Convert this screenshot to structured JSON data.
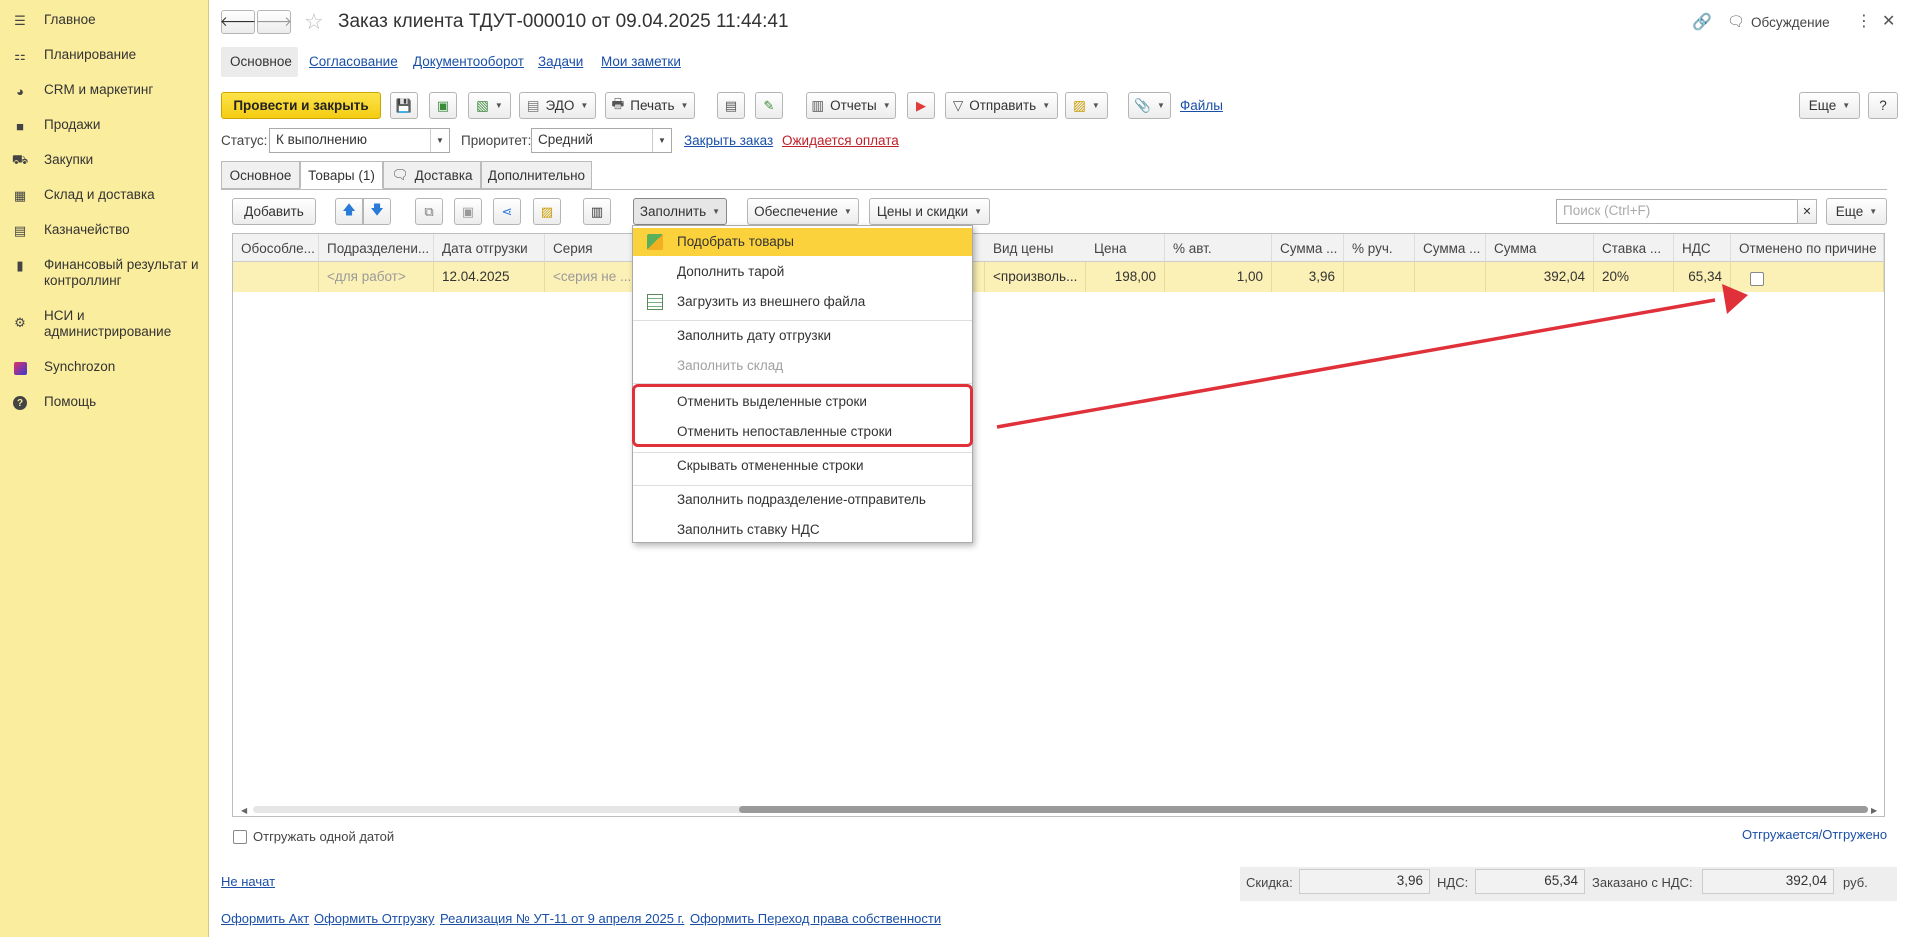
{
  "sidebar": {
    "items": [
      {
        "label": "Главное",
        "icon": "menu-icon"
      },
      {
        "label": "Планирование",
        "icon": "planning-icon"
      },
      {
        "label": "CRM и маркетинг",
        "icon": "pie-chart-icon"
      },
      {
        "label": "Продажи",
        "icon": "bag-icon"
      },
      {
        "label": "Закупки",
        "icon": "cart-icon"
      },
      {
        "label": "Склад и доставка",
        "icon": "warehouse-icon"
      },
      {
        "label": "Казначейство",
        "icon": "treasury-icon"
      },
      {
        "label": "Финансовый результат и контроллинг",
        "icon": "bar-chart-icon"
      },
      {
        "label": "НСИ и администрирование",
        "icon": "gear-icon"
      },
      {
        "label": "Synchrozon",
        "icon": "synchrozon-icon"
      },
      {
        "label": "Помощь",
        "icon": "help-icon"
      }
    ]
  },
  "header": {
    "title": "Заказ клиента ТДУТ-000010 от 09.04.2025 11:44:41",
    "discussion": "Обсуждение"
  },
  "nav_tabs": [
    "Основное",
    "Согласование",
    "Документооборот",
    "Задачи",
    "Мои заметки"
  ],
  "toolbar": {
    "post_close": "Провести и закрыть",
    "edo": "ЭДО",
    "print": "Печать",
    "reports": "Отчеты",
    "send": "Отправить",
    "files": "Файлы",
    "more": "Еще"
  },
  "status_row": {
    "status_label": "Статус:",
    "status_value": "К выполнению",
    "priority_label": "Приоритет:",
    "priority_value": "Средний",
    "close_order": "Закрыть заказ",
    "awaiting_payment": "Ожидается оплата"
  },
  "form_tabs": [
    "Основное",
    "Товары (1)",
    "Доставка",
    "Дополнительно"
  ],
  "goods_toolbar": {
    "add": "Добавить",
    "fill": "Заполнить",
    "provision": "Обеспечение",
    "prices": "Цены и скидки",
    "search_placeholder": "Поиск (Ctrl+F)",
    "more": "Еще"
  },
  "table": {
    "headers": [
      "Обособле...",
      "Подразделени...",
      "Дата отгрузки",
      "Серия",
      "Вид цены",
      "Цена",
      "% авт.",
      "Сумма ...",
      "% руч.",
      "Сумма ...",
      "Сумма",
      "Ставка ...",
      "НДС",
      "Отменено по причине"
    ],
    "row": [
      "",
      "<для работ>",
      "12.04.2025",
      "<серия не ...",
      "<произволь...",
      "198,00",
      "1,00",
      "3,96",
      "",
      "",
      "392,04",
      "20%",
      "65,34",
      ""
    ]
  },
  "fill_menu": {
    "items": [
      {
        "label": "Подобрать товары",
        "state": "selected"
      },
      {
        "label": "Дополнить тарой",
        "state": "normal"
      },
      {
        "label": "Загрузить из внешнего файла",
        "state": "normal"
      },
      {
        "label": "Заполнить дату отгрузки",
        "state": "normal"
      },
      {
        "label": "Заполнить склад",
        "state": "disabled"
      },
      {
        "label": "Отменить выделенные строки",
        "state": "normal"
      },
      {
        "label": "Отменить непоставленные строки",
        "state": "normal"
      },
      {
        "label": "Скрывать отмененные строки",
        "state": "normal"
      },
      {
        "label": "Заполнить подразделение-отправитель",
        "state": "normal"
      },
      {
        "label": "Заполнить ставку НДС",
        "state": "normal"
      }
    ]
  },
  "footer": {
    "ship_one_date": "Отгружать одной датой",
    "shipped_link": "Отгружается/Отгружено",
    "not_started": "Не начат",
    "discount_label": "Скидка:",
    "discount_value": "3,96",
    "vat_label": "НДС:",
    "vat_value": "65,34",
    "ordered_label": "Заказано с НДС:",
    "ordered_value": "392,04",
    "currency": "руб.",
    "links": [
      "Оформить Акт",
      "Оформить Отгрузку",
      "Реализация № УТ-11 от 9 апреля 2025 г.",
      "Оформить Переход права собственности"
    ]
  },
  "colors": {
    "sidebar_bg": "#fbed9e",
    "accent_yellow": "#f4cc12",
    "link_blue": "#1a4fa8",
    "highlight_red": "#e0303a"
  }
}
